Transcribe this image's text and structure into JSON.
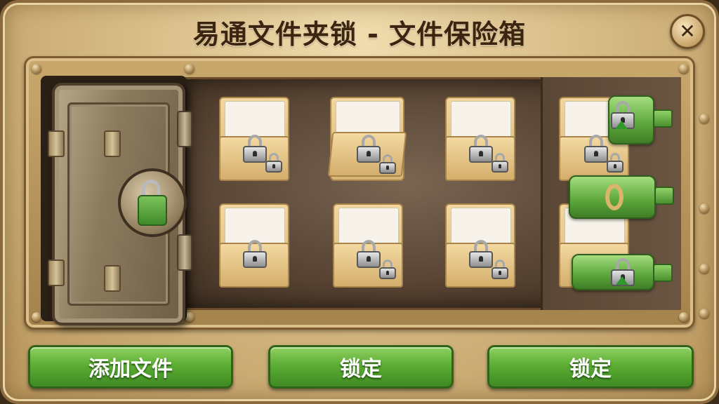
{
  "window": {
    "title": "易通文件夹锁 - 文件保险箱",
    "close_icon": "close-icon"
  },
  "vault": {
    "door_icon": "safe-door-icon",
    "door_lock_color": "#5ba53a",
    "folders": [
      {
        "icon": "folder-icon",
        "locks": [
          "padlock-icon",
          "padlock-small-icon"
        ]
      },
      {
        "icon": "folder-open-icon",
        "locks": [
          "padlock-icon",
          "padlock-small-icon"
        ]
      },
      {
        "icon": "folder-icon",
        "locks": [
          "padlock-icon",
          "padlock-small-icon"
        ]
      },
      {
        "icon": "folder-icon",
        "locks": [
          "padlock-icon"
        ]
      },
      {
        "icon": "folder-icon",
        "locks": [
          "padlock-icon",
          "padlock-small-icon"
        ]
      },
      {
        "icon": "folder-icon",
        "locks": [
          "padlock-icon",
          "padlock-small-icon"
        ]
      }
    ],
    "side_items": [
      {
        "icon": "green-lock-tag-icon"
      },
      {
        "icon": "green-ring-tag-icon"
      },
      {
        "icon": "green-lock-tag-icon"
      }
    ]
  },
  "actions": {
    "add_files": "添加文件",
    "lock_1": "锁定",
    "lock_2": "锁定"
  },
  "colors": {
    "button_green": "#5cae34",
    "frame_gold": "#d8bc86",
    "title_brown": "#3b2410"
  }
}
